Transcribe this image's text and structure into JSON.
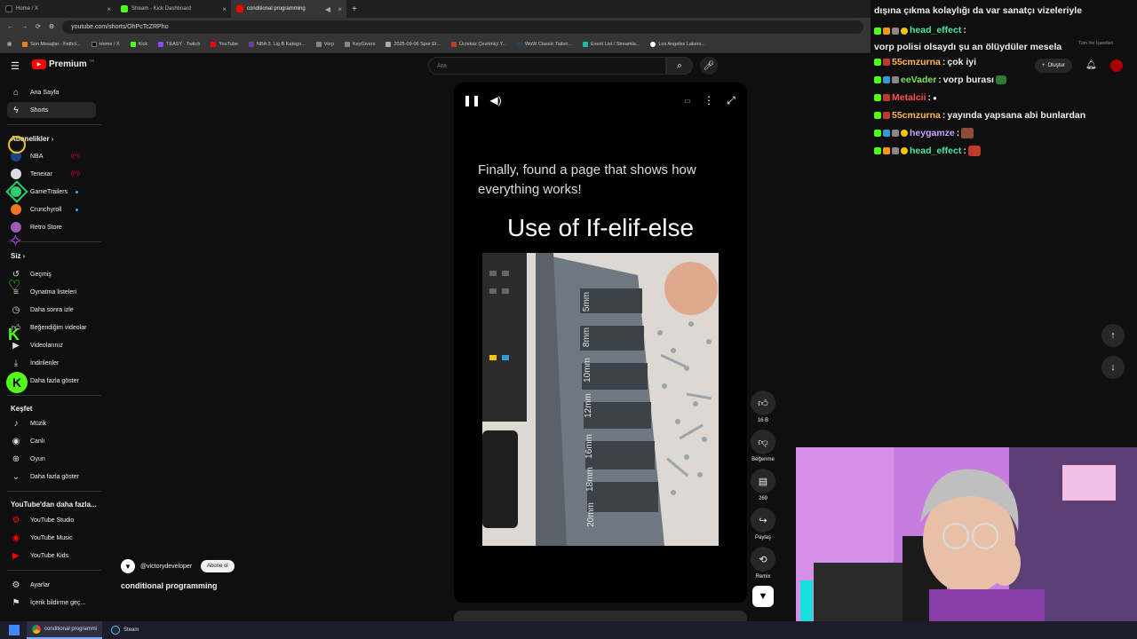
{
  "browser": {
    "tabs": [
      {
        "label": "Home / X",
        "color": "#111111"
      },
      {
        "label": "Stream - Kick Dashboard",
        "color": "#53fc18"
      },
      {
        "label": "conditional programming",
        "color": "#ff0000"
      }
    ],
    "url": "youtube.com/shorts/OhPcTcZRPho",
    "bookmarks": [
      {
        "label": "Son Mesajlar - Fatbci...",
        "color": "#e67e22"
      },
      {
        "label": "Home / X",
        "color": "#111111"
      },
      {
        "label": "Kick",
        "color": "#53fc18"
      },
      {
        "label": "TEASY - Twitch",
        "color": "#9146ff"
      },
      {
        "label": "YouTube",
        "color": "#ff0000"
      },
      {
        "label": "NBA 3. Lig B Katego...",
        "color": "#6b3fa0"
      },
      {
        "label": "Vorp",
        "color": "#888888"
      },
      {
        "label": "KeyGivers",
        "color": "#888888"
      },
      {
        "label": "2025-09-06 Spor Et...",
        "color": "#aaaaaa"
      },
      {
        "label": "Ücretsiz Çevrimiçi Y...",
        "color": "#c0392b"
      },
      {
        "label": "WoW Classic Tailori...",
        "color": "#2c3e50"
      },
      {
        "label": "Event List / Streamla...",
        "color": "#1abc9c"
      },
      {
        "label": "Los Angeles Lakers...",
        "color": "#ffffff"
      }
    ]
  },
  "youtube": {
    "logo": "Premium",
    "logo_sup": "TR",
    "search_placeholder": "Ara",
    "sidebar": {
      "home": "Ana Sayfa",
      "shorts": "Shorts",
      "subs_header": "Abonelikler",
      "subs": [
        {
          "label": "NBA",
          "color": "#1d428a"
        },
        {
          "label": "Tenexar",
          "color": "#ffffff"
        },
        {
          "label": "GameTrailers",
          "color": "#2ecc71"
        },
        {
          "label": "Crunchyroll",
          "color": "#f47521"
        },
        {
          "label": "Retro Store",
          "color": "#9b59b6"
        }
      ],
      "you_header": "Siz",
      "you_items": [
        "Geçmiş",
        "Oynatma listeleri",
        "Daha sonra izle",
        "Beğendiğim videolar",
        "Videolarınız",
        "İndirilenler",
        "Daha fazla göster"
      ],
      "explore_header": "Keşfet",
      "explore_items": [
        "Müzik",
        "Canlı",
        "Oyun",
        "Daha fazla göster"
      ],
      "more_header": "YouTube'dan daha fazla...",
      "more_items": [
        "YouTube Studio",
        "YouTube Music",
        "YouTube Kids"
      ],
      "settings_items": [
        "Ayarlar",
        "İçerik bildirme geç..."
      ]
    },
    "short": {
      "caption": "Finally, found a page that shows how everything works!",
      "big_title": "Use of If-elif-else",
      "photo_labels": [
        "5mm",
        "8mm",
        "10mm",
        "12mm",
        "16mm",
        "18mm",
        "20mm"
      ],
      "likes": "16 B",
      "dislike": "Beğenme",
      "comments": "269",
      "share": "Paylaş",
      "remix": "Remix",
      "channel": "@victorydeveloper",
      "subscribe": "Abone ol",
      "title": "conditional programming"
    },
    "create_label": "Oluştur"
  },
  "chat": {
    "top_line": "dışına çıkma kolaylığı da var sanatçı vizeleriyle",
    "messages": [
      {
        "user": "head_effect",
        "color": "#4ee3a0",
        "text": "vorp polisi olsaydı şu an ölüydüler mesela"
      },
      {
        "user": "55cmzurna",
        "color": "#ffb84d",
        "text": "çok iyi"
      },
      {
        "user": "eeVader",
        "color": "#7fe05a",
        "text": "vorp burası"
      },
      {
        "user": "Metalcii",
        "color": "#ff4d4d",
        "text": ""
      },
      {
        "user": "55cmzurna",
        "color": "#ffb84d",
        "text": "yayında yapsana abi bunlardan"
      },
      {
        "user": "heygamze",
        "color": "#c9a3ff",
        "text": ""
      },
      {
        "user": "head_effect",
        "color": "#4ee3a0",
        "text": ""
      }
    ],
    "overlay_text": "Tüm Yer İşaretleri"
  },
  "taskbar": {
    "items": [
      "conditional programmi",
      "Steam"
    ]
  }
}
